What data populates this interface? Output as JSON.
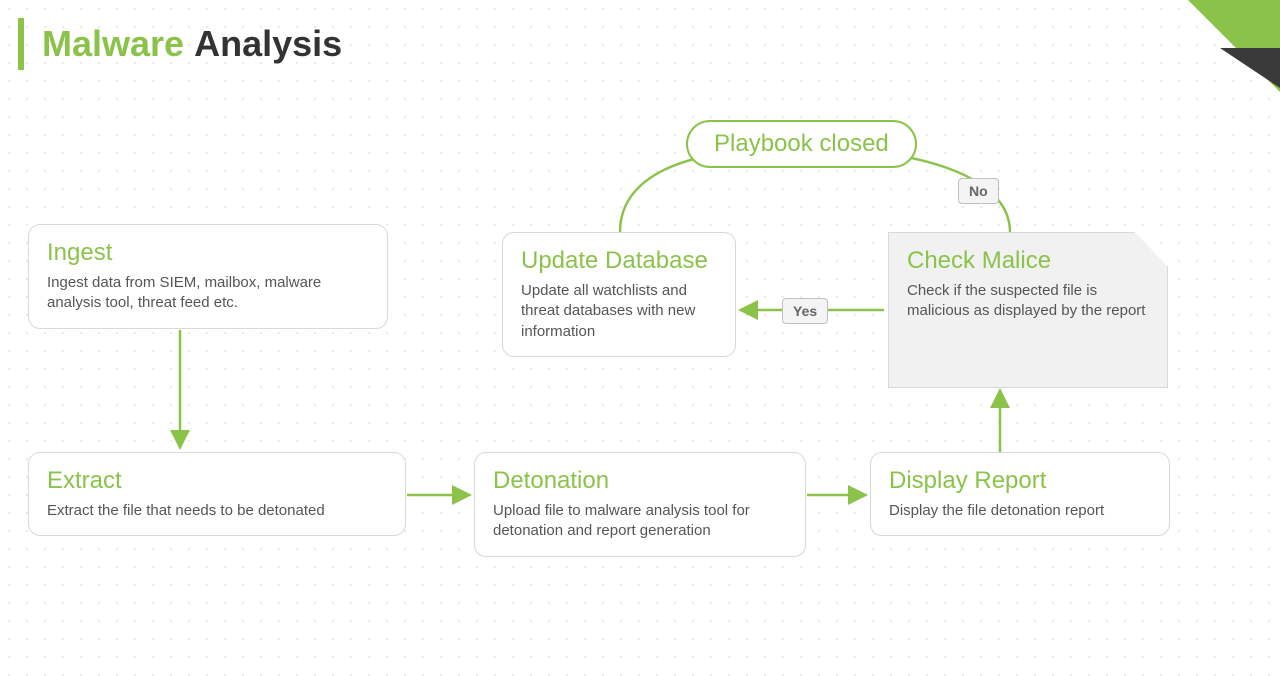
{
  "title": {
    "green": "Malware",
    "dark": "Analysis"
  },
  "nodes": {
    "ingest": {
      "title": "Ingest",
      "desc": "Ingest data from SIEM, mailbox, malware analysis tool, threat feed etc."
    },
    "extract": {
      "title": "Extract",
      "desc": "Extract the file that needs to be detonated"
    },
    "detonate": {
      "title": "Detonation",
      "desc": "Upload file to malware analysis tool for detonation and report generation"
    },
    "display": {
      "title": "Display Report",
      "desc": "Display the file detonation report"
    },
    "check": {
      "title": "Check Malice",
      "desc": "Check if the suspected file is malicious as displayed by the report"
    },
    "update": {
      "title": "Update Database",
      "desc": "Update all watchlists and threat databases with new information"
    },
    "closed": {
      "label": "Playbook closed"
    }
  },
  "labels": {
    "yes": "Yes",
    "no": "No"
  },
  "colors": {
    "accent": "#8bc34a"
  }
}
